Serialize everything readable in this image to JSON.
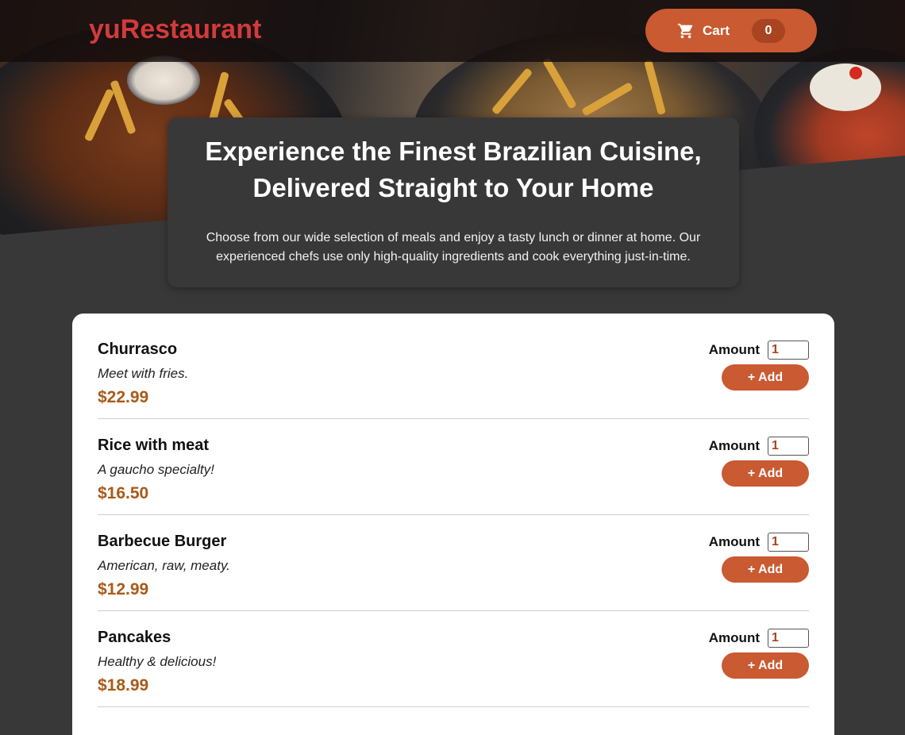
{
  "header": {
    "brand": "yuRestaurant",
    "cart": {
      "icon": "cart-icon",
      "label": "Cart",
      "count": "0"
    }
  },
  "summary": {
    "title_line1": "Experience the Finest Brazilian Cuisine,",
    "title_line2": "Delivered Straight to Your Home",
    "text_line1": "Choose from our wide selection of meals and enjoy a tasty lunch or dinner at home. Our",
    "text_line2": "experienced chefs use only high-quality ingredients and cook everything just-in-time."
  },
  "meals": [
    {
      "name": "Churrasco",
      "description": "Meet with fries.",
      "price": "$22.99",
      "amount_label": "Amount",
      "amount": "1",
      "add_label": "+ Add"
    },
    {
      "name": "Rice with meat",
      "description": "A gaucho specialty!",
      "price": "$16.50",
      "amount_label": "Amount",
      "amount": "1",
      "add_label": "+ Add"
    },
    {
      "name": "Barbecue Burger",
      "description": "American, raw, meaty.",
      "price": "$12.99",
      "amount_label": "Amount",
      "amount": "1",
      "add_label": "+ Add"
    },
    {
      "name": "Pancakes",
      "description": "Healthy & delicious!",
      "price": "$18.99",
      "amount_label": "Amount",
      "amount": "1",
      "add_label": "+ Add"
    }
  ],
  "colors": {
    "brand": "#d23b3b",
    "accent": "#c95a31",
    "price": "#a85a17",
    "background": "#383838"
  }
}
